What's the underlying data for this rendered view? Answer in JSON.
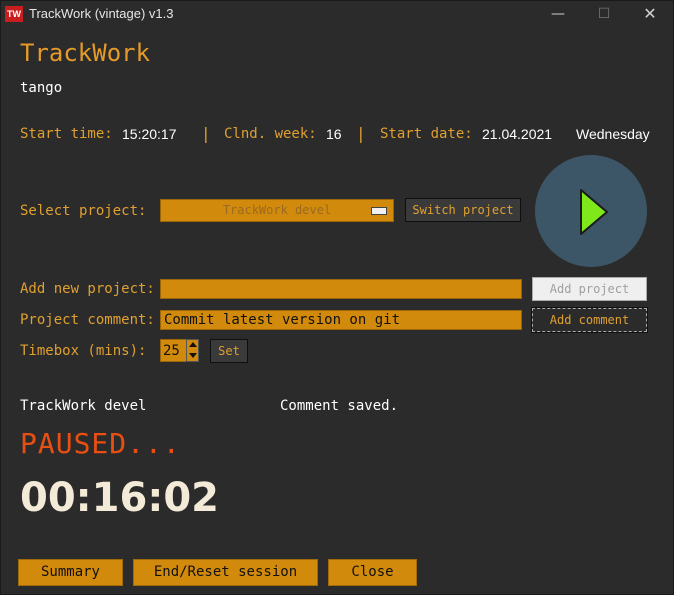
{
  "window": {
    "title": "TrackWork (vintage) v1.3",
    "icon_text": "TW",
    "minimize": "—",
    "maximize": "☐",
    "close": "✕"
  },
  "header": {
    "app_name": "TrackWork",
    "user": "tango"
  },
  "session": {
    "start_time_label": "Start time:",
    "start_time": "15:20:17",
    "separator": "|",
    "week_label": "Clnd. week:",
    "week": "16",
    "start_date_label": "Start date:",
    "start_date": "21.04.2021",
    "weekday": "Wednesday"
  },
  "project": {
    "select_label": "Select project:",
    "selected": "TrackWork devel",
    "switch_button": "Switch project",
    "add_label": "Add new project:",
    "add_value": "",
    "add_button": "Add project",
    "comment_label": "Project comment:",
    "comment_value": "Commit latest version on git",
    "comment_button": "Add comment",
    "timebox_label": "Timebox (mins):",
    "timebox_value": "25",
    "set_button": "Set"
  },
  "status": {
    "current_project": "TrackWork devel",
    "message": "Comment saved.",
    "state": "PAUSED...",
    "timer": "00:16:02"
  },
  "footer": {
    "summary_button": "Summary",
    "reset_button": "End/Reset session",
    "close_button": "Close"
  },
  "colors": {
    "accent": "#e0a030",
    "field": "#d28a0c",
    "paused": "#ea4f12",
    "play_bg": "#3d5667",
    "play_fg": "#7ee81a"
  },
  "icons": {
    "play": "play-icon"
  }
}
